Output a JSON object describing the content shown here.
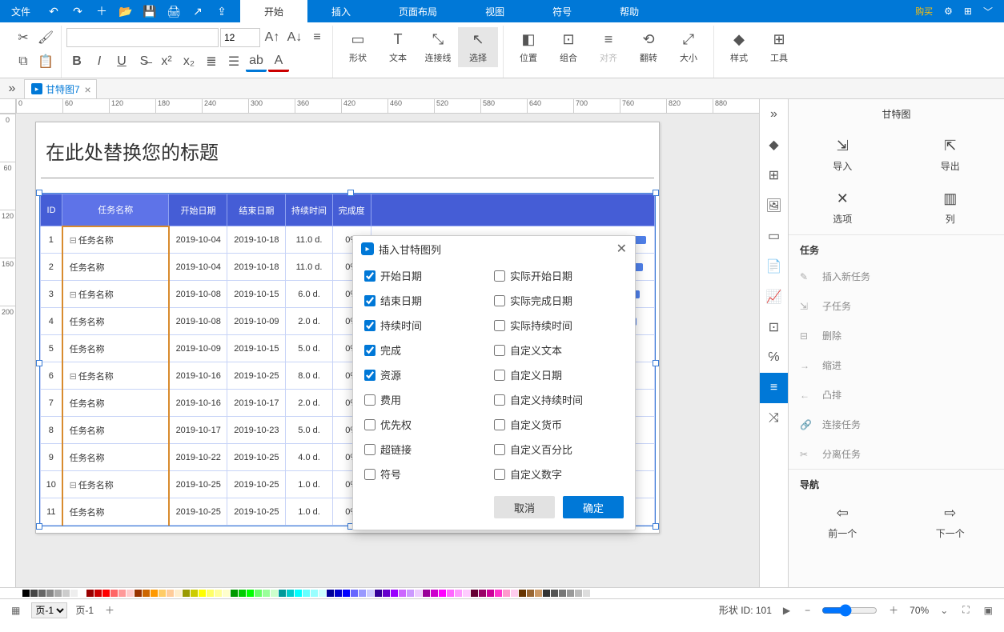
{
  "menu": {
    "file": "文件",
    "tabs": [
      "开始",
      "插入",
      "页面布局",
      "视图",
      "符号",
      "帮助"
    ],
    "active": 0,
    "buy": "购买"
  },
  "ribbon": {
    "font": "",
    "size": "12",
    "shape": "形状",
    "text": "文本",
    "connector": "连接线",
    "select": "选择",
    "position": "位置",
    "group": "组合",
    "align": "对齐",
    "flip": "翻转",
    "sizeLbl": "大小",
    "style": "样式",
    "tool": "工具"
  },
  "docTab": {
    "name": "甘特图7"
  },
  "page": {
    "title": "在此处替换您的标题"
  },
  "table": {
    "headers": {
      "id": "ID",
      "name": "任务名称",
      "start": "开始日期",
      "end": "结束日期",
      "dur": "持续时间",
      "done": "完成度"
    },
    "rows": [
      {
        "id": "1",
        "name": "任务名称",
        "start": "2019-10-04",
        "end": "2019-10-18",
        "dur": "11.0 d.",
        "pct": "0%",
        "exp": true
      },
      {
        "id": "2",
        "name": "任务名称",
        "start": "2019-10-04",
        "end": "2019-10-18",
        "dur": "11.0 d.",
        "pct": "0%"
      },
      {
        "id": "3",
        "name": "任务名称",
        "start": "2019-10-08",
        "end": "2019-10-15",
        "dur": "6.0 d.",
        "pct": "0%",
        "exp": true
      },
      {
        "id": "4",
        "name": "任务名称",
        "start": "2019-10-08",
        "end": "2019-10-09",
        "dur": "2.0 d.",
        "pct": "0%"
      },
      {
        "id": "5",
        "name": "任务名称",
        "start": "2019-10-09",
        "end": "2019-10-15",
        "dur": "5.0 d.",
        "pct": "0%"
      },
      {
        "id": "6",
        "name": "任务名称",
        "start": "2019-10-16",
        "end": "2019-10-25",
        "dur": "8.0 d.",
        "pct": "0%",
        "exp": true
      },
      {
        "id": "7",
        "name": "任务名称",
        "start": "2019-10-16",
        "end": "2019-10-17",
        "dur": "2.0 d.",
        "pct": "0%"
      },
      {
        "id": "8",
        "name": "任务名称",
        "start": "2019-10-17",
        "end": "2019-10-23",
        "dur": "5.0 d.",
        "pct": "0%"
      },
      {
        "id": "9",
        "name": "任务名称",
        "start": "2019-10-22",
        "end": "2019-10-25",
        "dur": "4.0 d.",
        "pct": "0%"
      },
      {
        "id": "10",
        "name": "任务名称",
        "start": "2019-10-25",
        "end": "2019-10-25",
        "dur": "1.0 d.",
        "pct": "0%",
        "exp": true
      },
      {
        "id": "11",
        "name": "任务名称",
        "start": "2019-10-25",
        "end": "2019-10-25",
        "dur": "1.0 d.",
        "pct": "0%"
      }
    ]
  },
  "dialog": {
    "title": "插入甘特图列",
    "left": [
      {
        "label": "开始日期",
        "checked": true
      },
      {
        "label": "结束日期",
        "checked": true
      },
      {
        "label": "持续时间",
        "checked": true
      },
      {
        "label": "完成",
        "checked": true
      },
      {
        "label": "资源",
        "checked": true
      },
      {
        "label": "费用",
        "checked": false
      },
      {
        "label": "优先权",
        "checked": false
      },
      {
        "label": "超链接",
        "checked": false
      },
      {
        "label": "符号",
        "checked": false
      }
    ],
    "right": [
      {
        "label": "实际开始日期",
        "checked": false
      },
      {
        "label": "实际完成日期",
        "checked": false
      },
      {
        "label": "实际持续时间",
        "checked": false
      },
      {
        "label": "自定义文本",
        "checked": false
      },
      {
        "label": "自定义日期",
        "checked": false
      },
      {
        "label": "自定义持续时间",
        "checked": false
      },
      {
        "label": "自定义货币",
        "checked": false
      },
      {
        "label": "自定义百分比",
        "checked": false
      },
      {
        "label": "自定义数字",
        "checked": false
      }
    ],
    "cancel": "取消",
    "ok": "确定"
  },
  "rpanel": {
    "title": "甘特图",
    "import": "导入",
    "export": "导出",
    "options": "选项",
    "column": "列",
    "secTask": "任务",
    "items": [
      "插入新任务",
      "子任务",
      "删除",
      "缩进",
      "凸排",
      "连接任务",
      "分离任务"
    ],
    "secNav": "导航",
    "prev": "前一个",
    "next": "下一个"
  },
  "status": {
    "pageSel": "页-1",
    "pageLabel": "页-1",
    "shapeId": "形状 ID:  101",
    "zoom": "70%"
  },
  "rulerH": [
    "0",
    "60",
    "120",
    "180",
    "240",
    "300",
    "360",
    "420",
    "460",
    "520",
    "580",
    "640",
    "700",
    "760",
    "820",
    "880"
  ],
  "rulerV": [
    "0",
    "60",
    "120",
    "160",
    "200"
  ]
}
